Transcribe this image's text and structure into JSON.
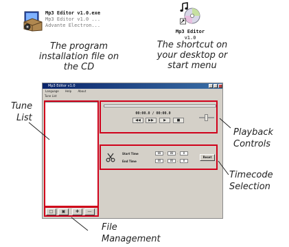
{
  "installer": {
    "icon": "installer-package-icon",
    "filename": "Mp3 Editor v1.0.exe",
    "description": "Mp3 Editor v1.0 ...",
    "company": "Advante Electron..."
  },
  "installer_caption": [
    "The program",
    "installation file on",
    "the CD"
  ],
  "shortcut": {
    "icon": "music-cd-shortcut-icon",
    "name_line1": "Mp3 Editor",
    "name_line2": "v1.0"
  },
  "shortcut_caption": [
    "The shortcut on",
    "your desktop or",
    "start menu"
  ],
  "app": {
    "title": "Mp3 Editor v1.0",
    "menu": [
      "Language",
      "Help",
      "About"
    ],
    "tune_list_caption": "Tune List",
    "playback": {
      "time": "00:00.0 / 00:00.0",
      "buttons": [
        "◀◀",
        "▶▶",
        "▶",
        "■"
      ]
    },
    "timecode": {
      "start_label": "Start Time",
      "end_label": "End Time",
      "start": [
        "00",
        "00",
        "0"
      ],
      "end": [
        "00",
        "00",
        "0"
      ],
      "reset": "Reset"
    },
    "file_buttons": [
      "□",
      "▣",
      "✚",
      "—"
    ]
  },
  "labels": {
    "tune_list": [
      "Tune",
      "List"
    ],
    "playback": [
      "Playback",
      "Controls"
    ],
    "timecode": [
      "Timecode",
      "Selection"
    ],
    "file_management": [
      "File",
      "Management"
    ]
  },
  "colors": {
    "highlight": "#d0001a",
    "window_face": "#d4d0c8",
    "title_bar": "#0a246a"
  }
}
